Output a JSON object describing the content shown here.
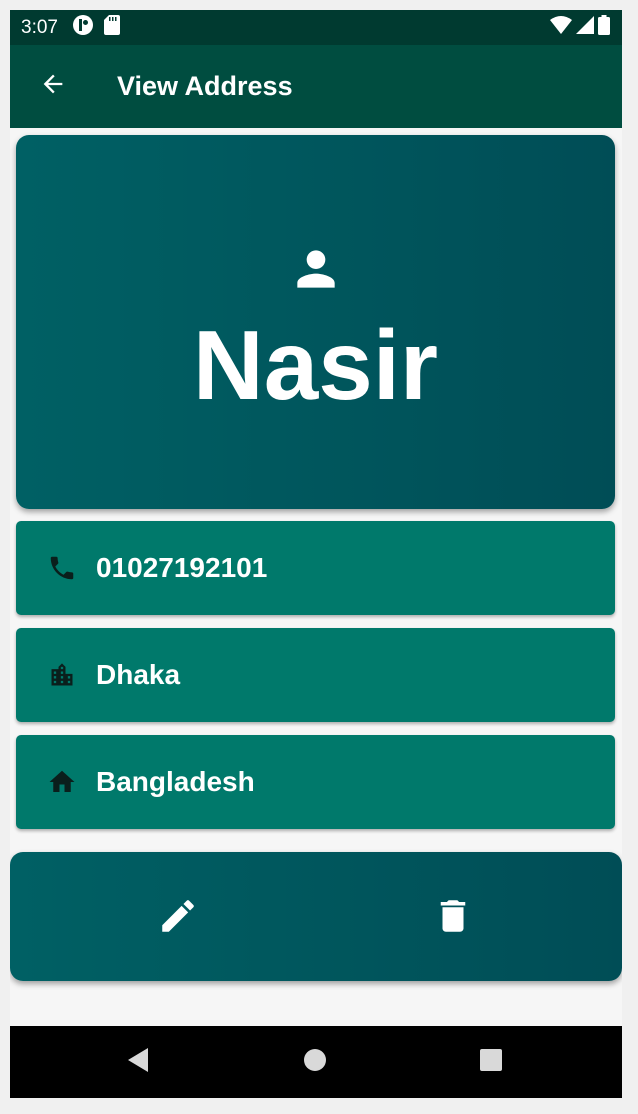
{
  "status_bar": {
    "time": "3:07",
    "icons_left": [
      "app-notification-icon",
      "sd-card-icon"
    ],
    "icons_right": [
      "wifi-icon",
      "cell-signal-icon",
      "battery-icon"
    ]
  },
  "app_bar": {
    "title": "View Address",
    "back_icon": "arrow-back-icon"
  },
  "contact": {
    "name": "Nasir",
    "avatar_icon": "person-icon"
  },
  "details": [
    {
      "icon": "phone-icon",
      "text": "01027192101"
    },
    {
      "icon": "city-icon",
      "text": "Dhaka"
    },
    {
      "icon": "home-icon",
      "text": "Bangladesh"
    }
  ],
  "actions": {
    "edit_icon": "edit-icon",
    "delete_icon": "delete-icon"
  },
  "colors": {
    "status_bar": "#003a30",
    "app_bar": "#004d40",
    "card_gradient_start": "#006064",
    "card_gradient_end": "#004d56",
    "detail_row": "#00796b",
    "icon_dark": "#0a1f1c"
  }
}
